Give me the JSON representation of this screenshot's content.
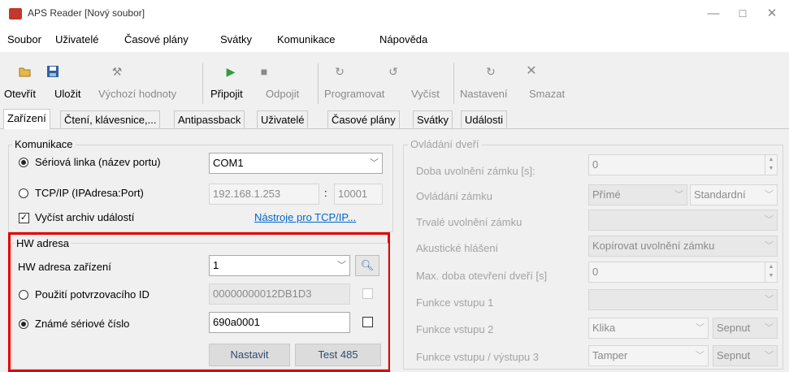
{
  "window": {
    "title": "APS Reader [Nový soubor]",
    "min": "—",
    "max": "☐",
    "close": "✕"
  },
  "menu": [
    "Soubor",
    "Uživatelé",
    "Časové plány",
    "Svátky",
    "Komunikace",
    "Nápověda"
  ],
  "toolbar": {
    "open": "Otevřít",
    "save": "Uložit",
    "defaults": "Výchozí hodnoty",
    "connect": "Připojit",
    "disconnect": "Odpojit",
    "program": "Programovat",
    "read": "Vyčíst",
    "settings": "Nastavení",
    "delete": "Smazat"
  },
  "tabs": [
    "Zařízení",
    "Čtení, klávesnice,...",
    "Antipassback",
    "Uživatelé",
    "Časové plány",
    "Svátky",
    "Události"
  ],
  "komunikace": {
    "label": "Komunikace",
    "serial_label": "Sériová linka (název portu)",
    "serial_value": "COM1",
    "tcp_label": "TCP/IP (IPAdresa:Port)",
    "tcp_ip": "192.168.1.253",
    "colon": ":",
    "tcp_port": "10001",
    "archive_label": "Vyčíst archiv událostí",
    "tools_link": "Nástroje pro TCP/IP..."
  },
  "hw": {
    "label": "HW adresa",
    "address_label": "HW adresa zařízení",
    "address_value": "1",
    "confirm_label": "Použití potvrzovacího ID",
    "confirm_value": "00000000012DB1D3",
    "serial_label": "Známé sériové číslo",
    "serial_value": "690a0001",
    "set_button": "Nastavit",
    "test_button": "Test 485"
  },
  "door": {
    "label": "Ovládání dveří",
    "release_time_label": "Doba uvolnění zámku [s]:",
    "release_time_value": "0",
    "lock_control_label": "Ovládání zámku",
    "lock_control_value": "Přímé",
    "lock_control_mode": "Standardní",
    "permanent_release_label": "Trvalé uvolnění zámku",
    "acoustic_label": "Akustické hlášení",
    "acoustic_value": "Kopírovat uvolnění zámku",
    "max_open_label": "Max. doba otevření dveří [s]",
    "max_open_value": "0",
    "input1_label": "Funkce vstupu 1",
    "input2_label": "Funkce vstupu 2",
    "input2_value": "Klika",
    "input2_mode": "Sepnut",
    "io3_label": "Funkce vstupu / výstupu 3",
    "io3_value": "Tamper",
    "io3_mode": "Sepnut"
  }
}
